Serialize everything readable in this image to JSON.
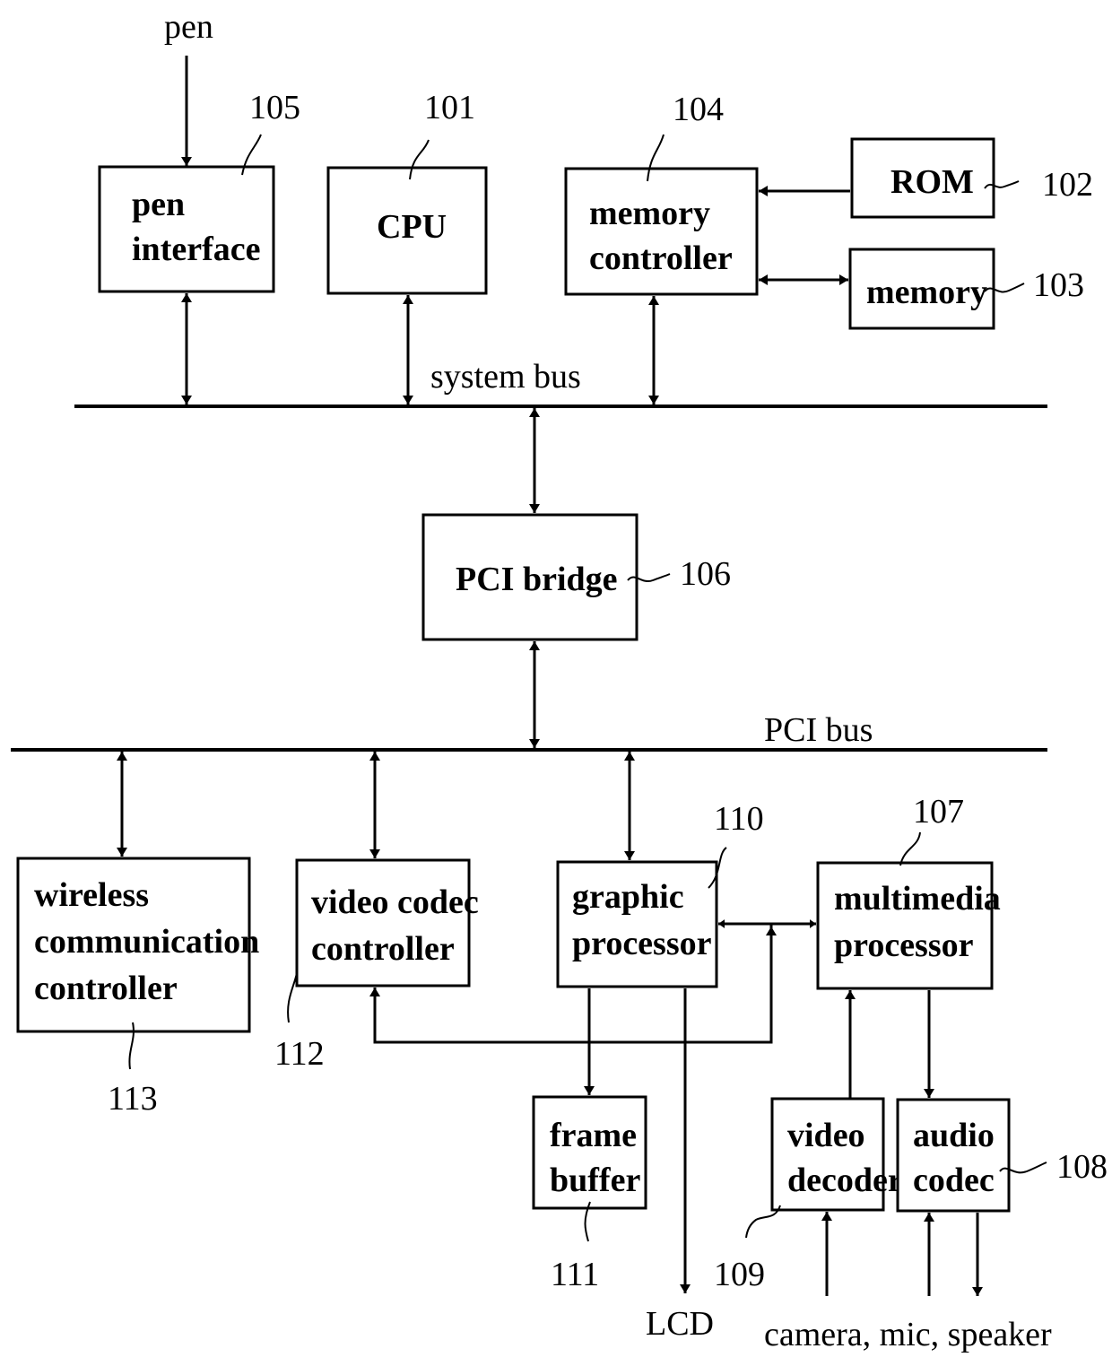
{
  "diagram": {
    "type": "block-diagram",
    "buses": {
      "system_bus": "system bus",
      "pci_bus": "PCI bus"
    },
    "blocks": {
      "pen_interface": {
        "lines": [
          "pen",
          "interface"
        ],
        "ref": "105"
      },
      "cpu": {
        "lines": [
          "CPU"
        ],
        "ref": "101"
      },
      "memory_controller": {
        "lines": [
          "memory",
          "controller"
        ],
        "ref": "104"
      },
      "rom": {
        "lines": [
          "ROM"
        ],
        "ref": "102"
      },
      "memory": {
        "lines": [
          "memory"
        ],
        "ref": "103"
      },
      "pci_bridge": {
        "lines": [
          "PCI bridge"
        ],
        "ref": "106"
      },
      "wireless_controller": {
        "lines": [
          "wireless",
          "communication",
          "controller"
        ],
        "ref": "113"
      },
      "video_codec_controller": {
        "lines": [
          "video codec",
          "controller"
        ],
        "ref": "112"
      },
      "graphic_processor": {
        "lines": [
          "graphic",
          "processor"
        ],
        "ref": "110"
      },
      "multimedia_processor": {
        "lines": [
          "multimedia",
          "processor"
        ],
        "ref": "107"
      },
      "frame_buffer": {
        "lines": [
          "frame",
          "buffer"
        ],
        "ref": "111"
      },
      "video_decoder": {
        "lines": [
          "video",
          "decoder"
        ],
        "ref": "109"
      },
      "audio_codec": {
        "lines": [
          "audio",
          "codec"
        ],
        "ref": "108"
      }
    },
    "external": {
      "pen": "pen",
      "lcd": "LCD",
      "av_io": "camera, mic, speaker"
    }
  }
}
